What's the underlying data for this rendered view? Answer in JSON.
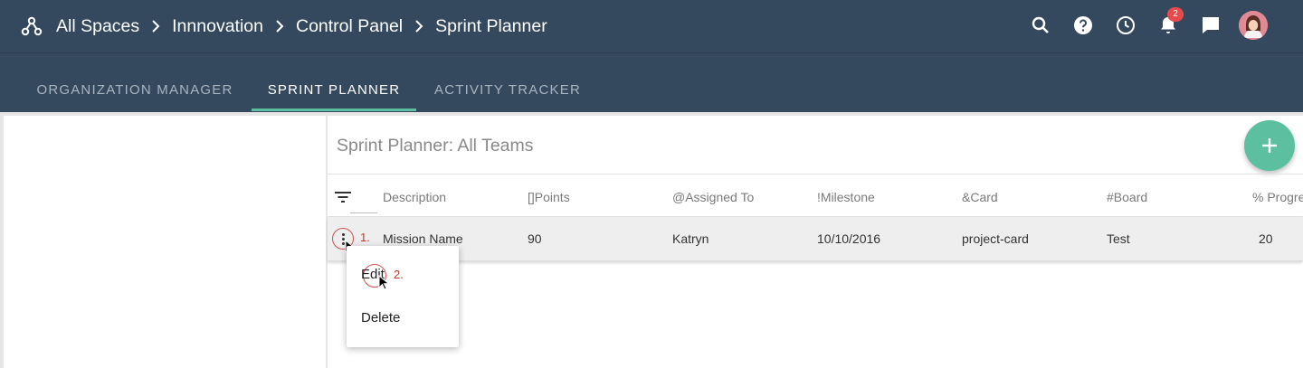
{
  "breadcrumbs": [
    "All Spaces",
    "Innnovation",
    "Control Panel",
    "Sprint Planner"
  ],
  "top_icons": [
    "search-icon",
    "help-icon",
    "clock-icon",
    "bell-icon",
    "chat-icon"
  ],
  "notification_count": "2",
  "tabs": [
    {
      "label": "ORGANIZATION MANAGER",
      "active": false
    },
    {
      "label": "SPRINT PLANNER",
      "active": true
    },
    {
      "label": "ACTIVITY TRACKER",
      "active": false
    }
  ],
  "panel": {
    "title": "Sprint Planner: All Teams"
  },
  "table": {
    "columns": [
      "Description",
      "[]Points",
      "@Assigned To",
      "!Milestone",
      "&Card",
      "#Board",
      "% Progre"
    ],
    "row": [
      "Mission Name",
      "90",
      "Katryn",
      "10/10/2016",
      "project-card",
      "Test",
      "20"
    ]
  },
  "context_menu": {
    "items": [
      "Edit",
      "Delete"
    ]
  },
  "steps": [
    "1.",
    "2."
  ],
  "colors": {
    "header": "#34495e",
    "accent": "#5cbfa0",
    "annotation": "#d15151"
  }
}
